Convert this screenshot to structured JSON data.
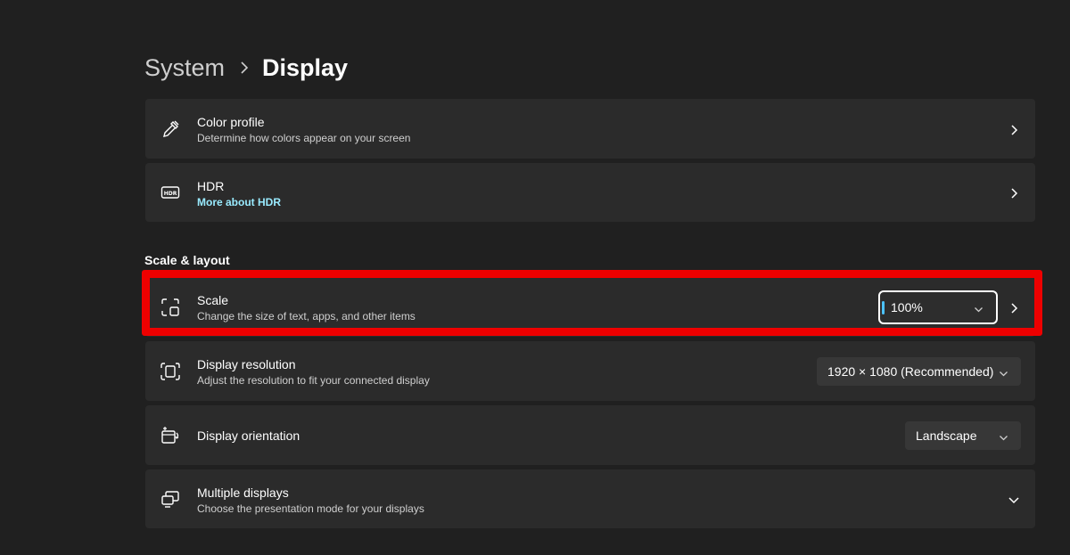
{
  "breadcrumb": {
    "parent": "System",
    "separator_icon": "chevron-right-icon",
    "current": "Display"
  },
  "cards_top": [
    {
      "icon": "color-picker-icon",
      "title": "Color profile",
      "subtitle": "Determine how colors appear on your screen",
      "action_icon": "chevron-right-icon"
    },
    {
      "icon": "hdr-icon",
      "title": "HDR",
      "link": "More about HDR",
      "action_icon": "chevron-right-icon"
    }
  ],
  "section": {
    "title": "Scale & layout"
  },
  "scale": {
    "icon": "scale-icon",
    "title": "Scale",
    "subtitle": "Change the size of text, apps, and other items",
    "value": "100%",
    "action_icon": "chevron-right-icon"
  },
  "resolution": {
    "icon": "resolution-icon",
    "title": "Display resolution",
    "subtitle": "Adjust the resolution to fit your connected display",
    "value": "1920 × 1080 (Recommended)"
  },
  "orientation": {
    "icon": "orientation-icon",
    "title": "Display orientation",
    "value": "Landscape"
  },
  "multiple_displays": {
    "icon": "multiple-displays-icon",
    "title": "Multiple displays",
    "subtitle": "Choose the presentation mode for your displays",
    "action_icon": "chevron-down-icon"
  },
  "colors": {
    "background": "#202020",
    "card": "#2b2b2b",
    "link": "#99ebff",
    "accent": "#4cc2ff",
    "highlight": "#ee0000"
  }
}
